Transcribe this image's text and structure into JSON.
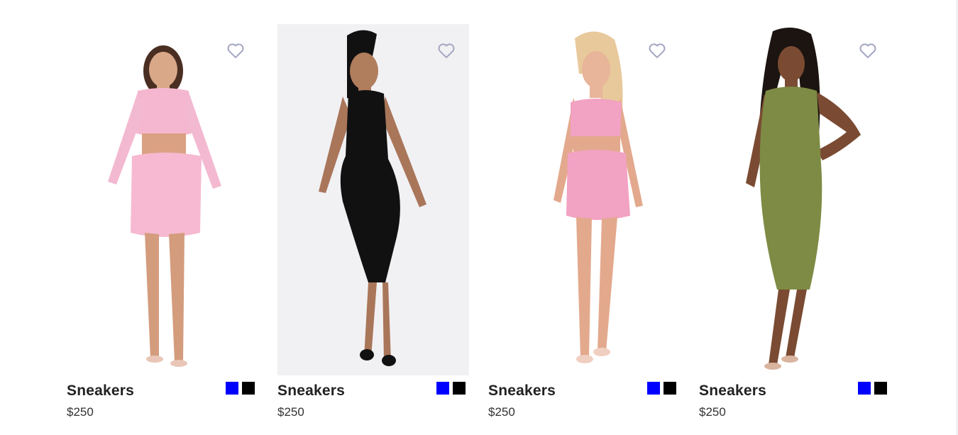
{
  "products": [
    {
      "name": "Sneakers",
      "price": "$250",
      "swatches": [
        "#0000ff",
        "#000000"
      ],
      "image": "model-pink-crop-top-skirt"
    },
    {
      "name": "Sneakers",
      "price": "$250",
      "swatches": [
        "#0000ff",
        "#000000"
      ],
      "image": "model-black-halter-dress"
    },
    {
      "name": "Sneakers",
      "price": "$250",
      "swatches": [
        "#0000ff",
        "#000000"
      ],
      "image": "model-pink-bustier-skirt"
    },
    {
      "name": "Sneakers",
      "price": "$250",
      "swatches": [
        "#0000ff",
        "#000000"
      ],
      "image": "model-olive-midi-dress"
    }
  ],
  "icons": {
    "wishlist": "heart-outline-icon"
  },
  "colors": {
    "heart": "#a3a5c2",
    "text": "#222222"
  }
}
